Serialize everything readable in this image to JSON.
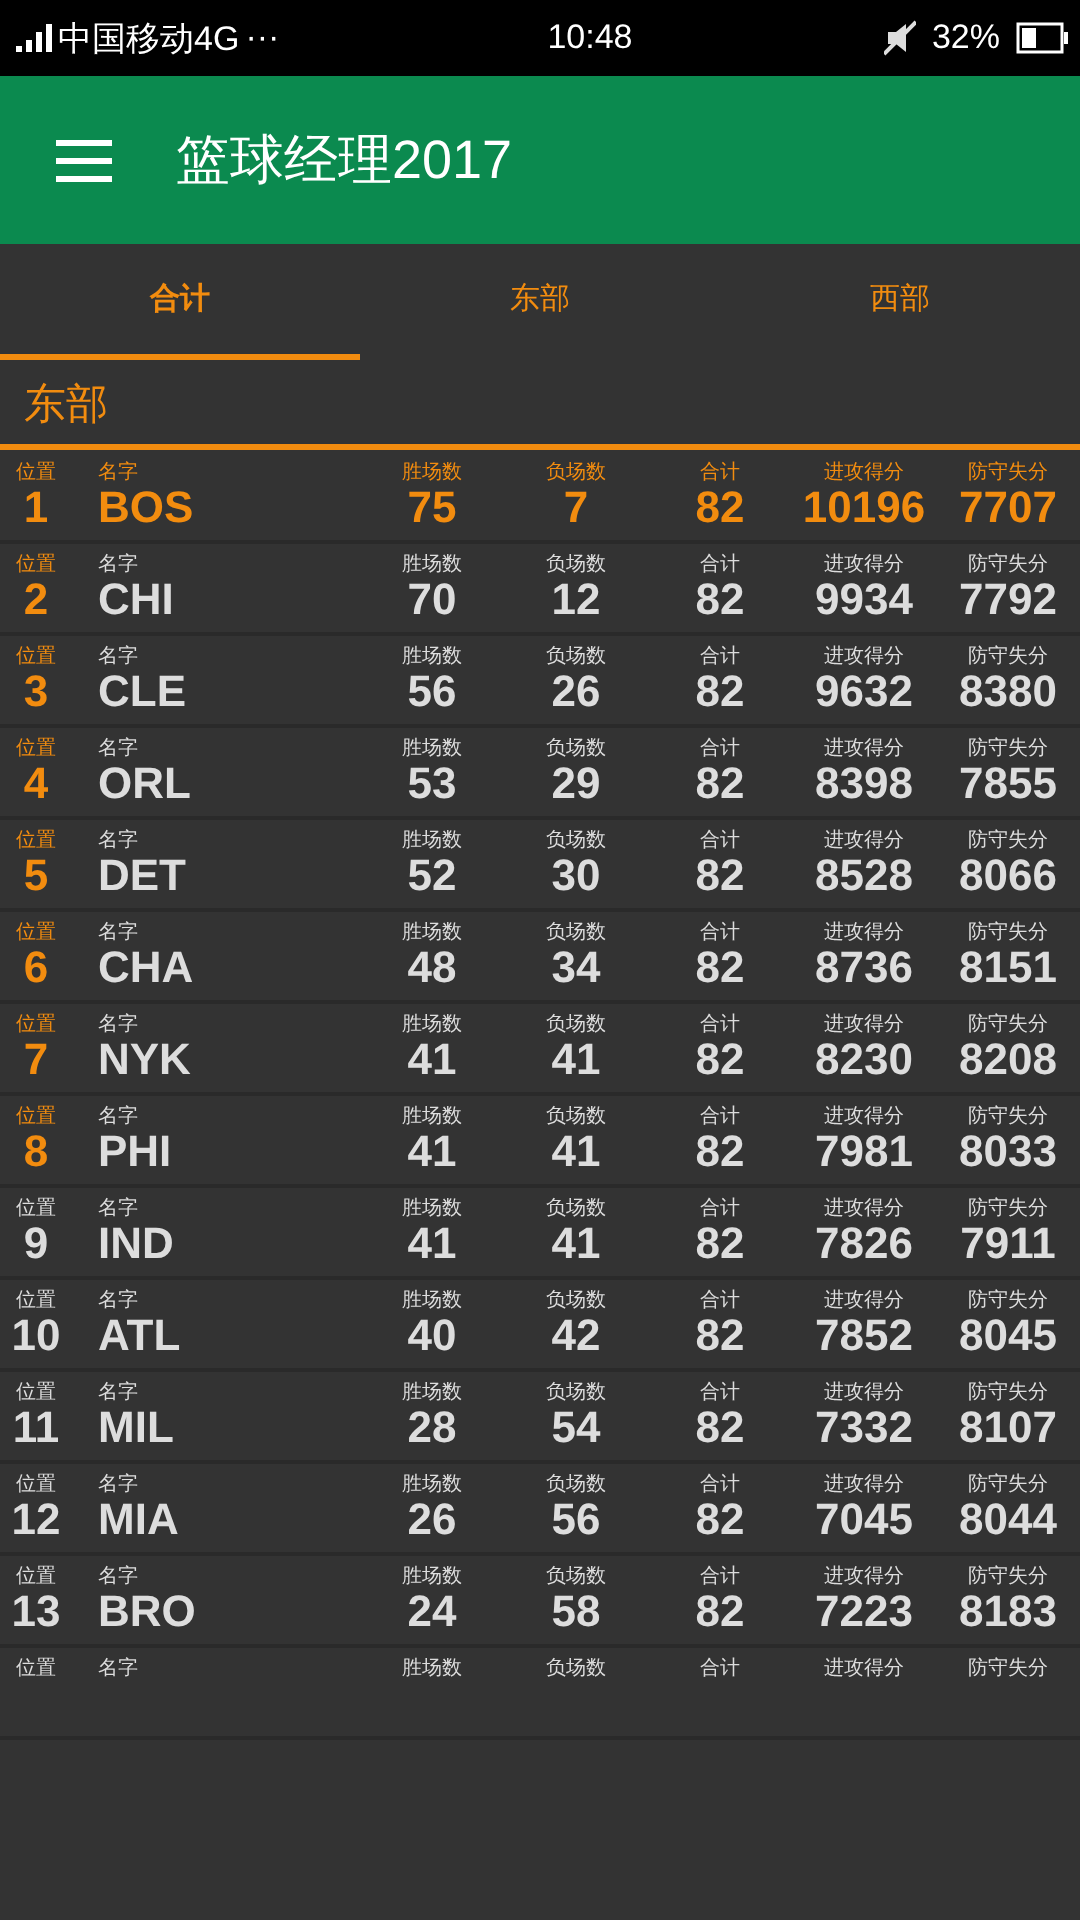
{
  "status_bar": {
    "carrier": "中国移动4G",
    "more": "···",
    "time": "10:48",
    "battery": "32%"
  },
  "app_bar": {
    "title": "篮球经理2017"
  },
  "tabs": [
    {
      "label": "合计",
      "selected": true
    },
    {
      "label": "东部",
      "selected": false
    },
    {
      "label": "西部",
      "selected": false
    }
  ],
  "section": {
    "title": "东部"
  },
  "rows": [
    {
      "highlighted": true,
      "color": "#f28c0f",
      "labels": [
        "位置",
        "名字",
        "胜场数",
        "负场数",
        "合计",
        "进攻得分",
        "防守失分"
      ],
      "values": [
        "1",
        "BOS",
        "75",
        "7",
        "82",
        "10196",
        "7707"
      ]
    },
    {
      "highlighted": false,
      "color": "#f28c0f",
      "labels": [
        "位置",
        "名字",
        "胜场数",
        "负场数",
        "合计",
        "进攻得分",
        "防守失分"
      ],
      "values": [
        "2",
        "CHI",
        "70",
        "12",
        "82",
        "9934",
        "7792"
      ]
    },
    {
      "highlighted": false,
      "color": "#f28c0f",
      "labels": [
        "位置",
        "名字",
        "胜场数",
        "负场数",
        "合计",
        "进攻得分",
        "防守失分"
      ],
      "values": [
        "3",
        "CLE",
        "56",
        "26",
        "82",
        "9632",
        "8380"
      ]
    },
    {
      "highlighted": false,
      "color": "#f28c0f",
      "labels": [
        "位置",
        "名字",
        "胜场数",
        "负场数",
        "合计",
        "进攻得分",
        "防守失分"
      ],
      "values": [
        "4",
        "ORL",
        "53",
        "29",
        "82",
        "8398",
        "7855"
      ]
    },
    {
      "highlighted": false,
      "color": "#f28c0f",
      "labels": [
        "位置",
        "名字",
        "胜场数",
        "负场数",
        "合计",
        "进攻得分",
        "防守失分"
      ],
      "values": [
        "5",
        "DET",
        "52",
        "30",
        "82",
        "8528",
        "8066"
      ]
    },
    {
      "highlighted": false,
      "color": "#f28c0f",
      "labels": [
        "位置",
        "名字",
        "胜场数",
        "负场数",
        "合计",
        "进攻得分",
        "防守失分"
      ],
      "values": [
        "6",
        "CHA",
        "48",
        "34",
        "82",
        "8736",
        "8151"
      ]
    },
    {
      "highlighted": false,
      "color": "#f28c0f",
      "labels": [
        "位置",
        "名字",
        "胜场数",
        "负场数",
        "合计",
        "进攻得分",
        "防守失分"
      ],
      "values": [
        "7",
        "NYK",
        "41",
        "41",
        "82",
        "8230",
        "8208"
      ]
    },
    {
      "highlighted": false,
      "color": "#f28c0f",
      "labels": [
        "位置",
        "名字",
        "胜场数",
        "负场数",
        "合计",
        "进攻得分",
        "防守失分"
      ],
      "values": [
        "8",
        "PHI",
        "41",
        "41",
        "82",
        "7981",
        "8033"
      ]
    },
    {
      "highlighted": false,
      "color": "#dddddd",
      "labels": [
        "位置",
        "名字",
        "胜场数",
        "负场数",
        "合计",
        "进攻得分",
        "防守失分"
      ],
      "values": [
        "9",
        "IND",
        "41",
        "41",
        "82",
        "7826",
        "7911"
      ]
    },
    {
      "highlighted": false,
      "color": "#dddddd",
      "labels": [
        "位置",
        "名字",
        "胜场数",
        "负场数",
        "合计",
        "进攻得分",
        "防守失分"
      ],
      "values": [
        "10",
        "ATL",
        "40",
        "42",
        "82",
        "7852",
        "8045"
      ]
    },
    {
      "highlighted": false,
      "color": "#dddddd",
      "labels": [
        "位置",
        "名字",
        "胜场数",
        "负场数",
        "合计",
        "进攻得分",
        "防守失分"
      ],
      "values": [
        "11",
        "MIL",
        "28",
        "54",
        "82",
        "7332",
        "8107"
      ]
    },
    {
      "highlighted": false,
      "color": "#dddddd",
      "labels": [
        "位置",
        "名字",
        "胜场数",
        "负场数",
        "合计",
        "进攻得分",
        "防守失分"
      ],
      "values": [
        "12",
        "MIA",
        "26",
        "56",
        "82",
        "7045",
        "8044"
      ]
    },
    {
      "highlighted": false,
      "color": "#dddddd",
      "labels": [
        "位置",
        "名字",
        "胜场数",
        "负场数",
        "合计",
        "进攻得分",
        "防守失分"
      ],
      "values": [
        "13",
        "BRO",
        "24",
        "58",
        "82",
        "7223",
        "8183"
      ]
    },
    {
      "highlighted": false,
      "color": "#dddddd",
      "labels": [
        "位置",
        "名字",
        "胜场数",
        "负场数",
        "合计",
        "进攻得分",
        "防守失分"
      ]
    }
  ]
}
